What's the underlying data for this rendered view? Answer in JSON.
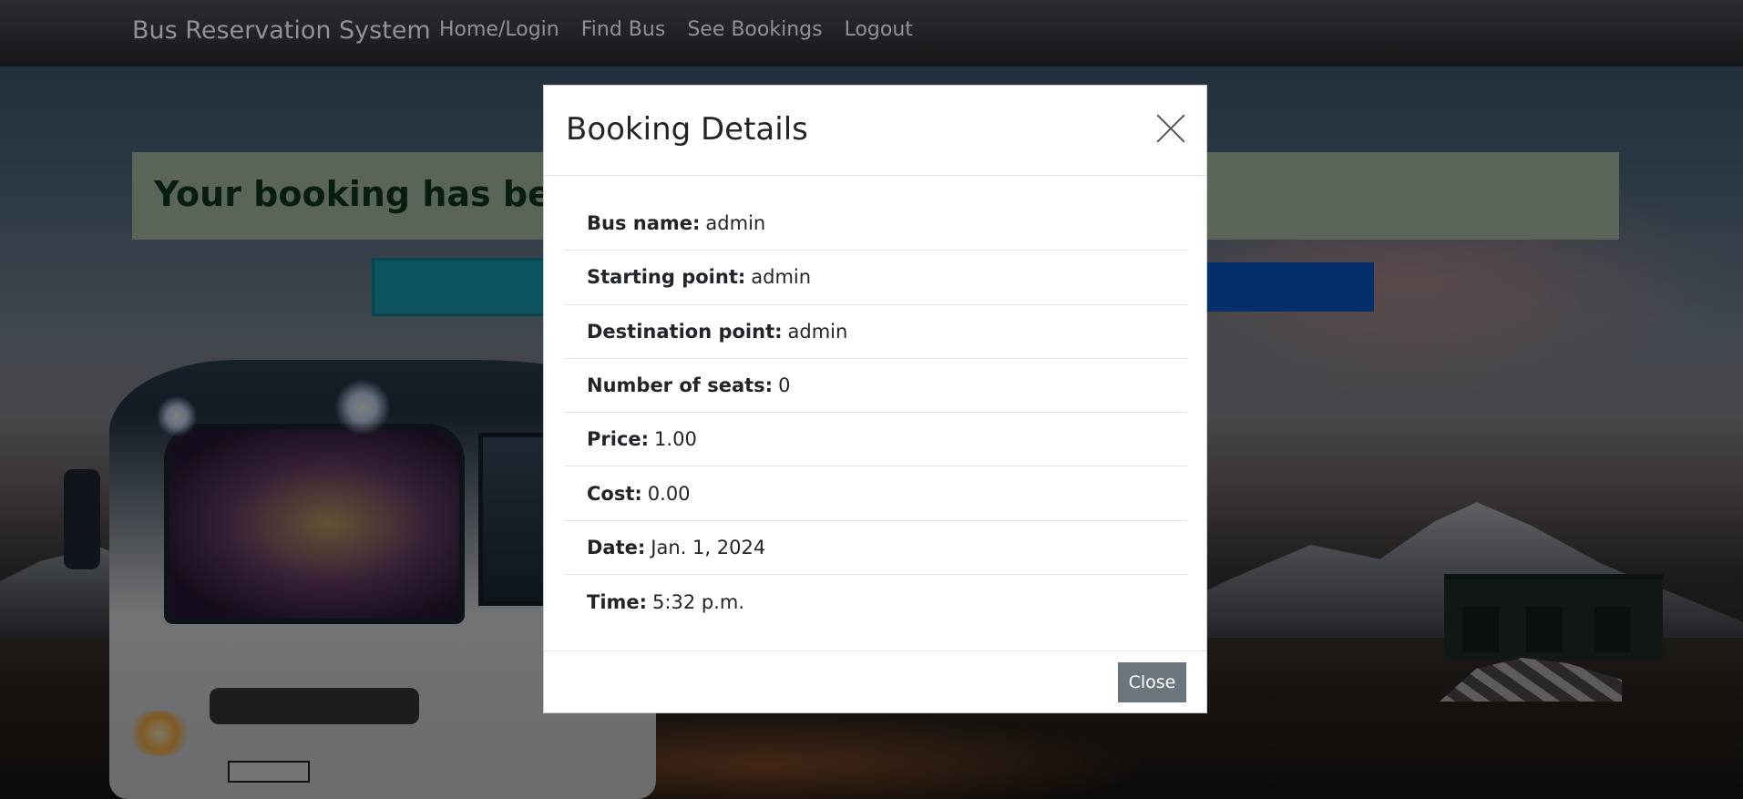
{
  "navbar": {
    "brand": "Bus Reservation System",
    "links": [
      "Home/Login",
      "Find Bus",
      "See Bookings",
      "Logout"
    ]
  },
  "alert": {
    "text": "Your booking has been"
  },
  "modal": {
    "title": "Booking Details",
    "details": [
      {
        "label": "Bus name:",
        "value": "admin"
      },
      {
        "label": "Starting point:",
        "value": "admin"
      },
      {
        "label": "Destination point:",
        "value": "admin"
      },
      {
        "label": "Number of seats:",
        "value": "0"
      },
      {
        "label": "Price:",
        "value": "1.00"
      },
      {
        "label": "Cost:",
        "value": "0.00"
      },
      {
        "label": "Date:",
        "value": "Jan. 1, 2024"
      },
      {
        "label": "Time:",
        "value": "5:32 p.m."
      }
    ],
    "close_label": "Close"
  },
  "colors": {
    "navbar": "#161719",
    "alert_bg": "#b7c8b3",
    "alert_text": "#0e3a23",
    "teal_button": "#1aa6bd",
    "blue_button": "#0b5ed7",
    "close_button": "#6c757d"
  },
  "icons": {
    "modal_close": "close-icon"
  }
}
